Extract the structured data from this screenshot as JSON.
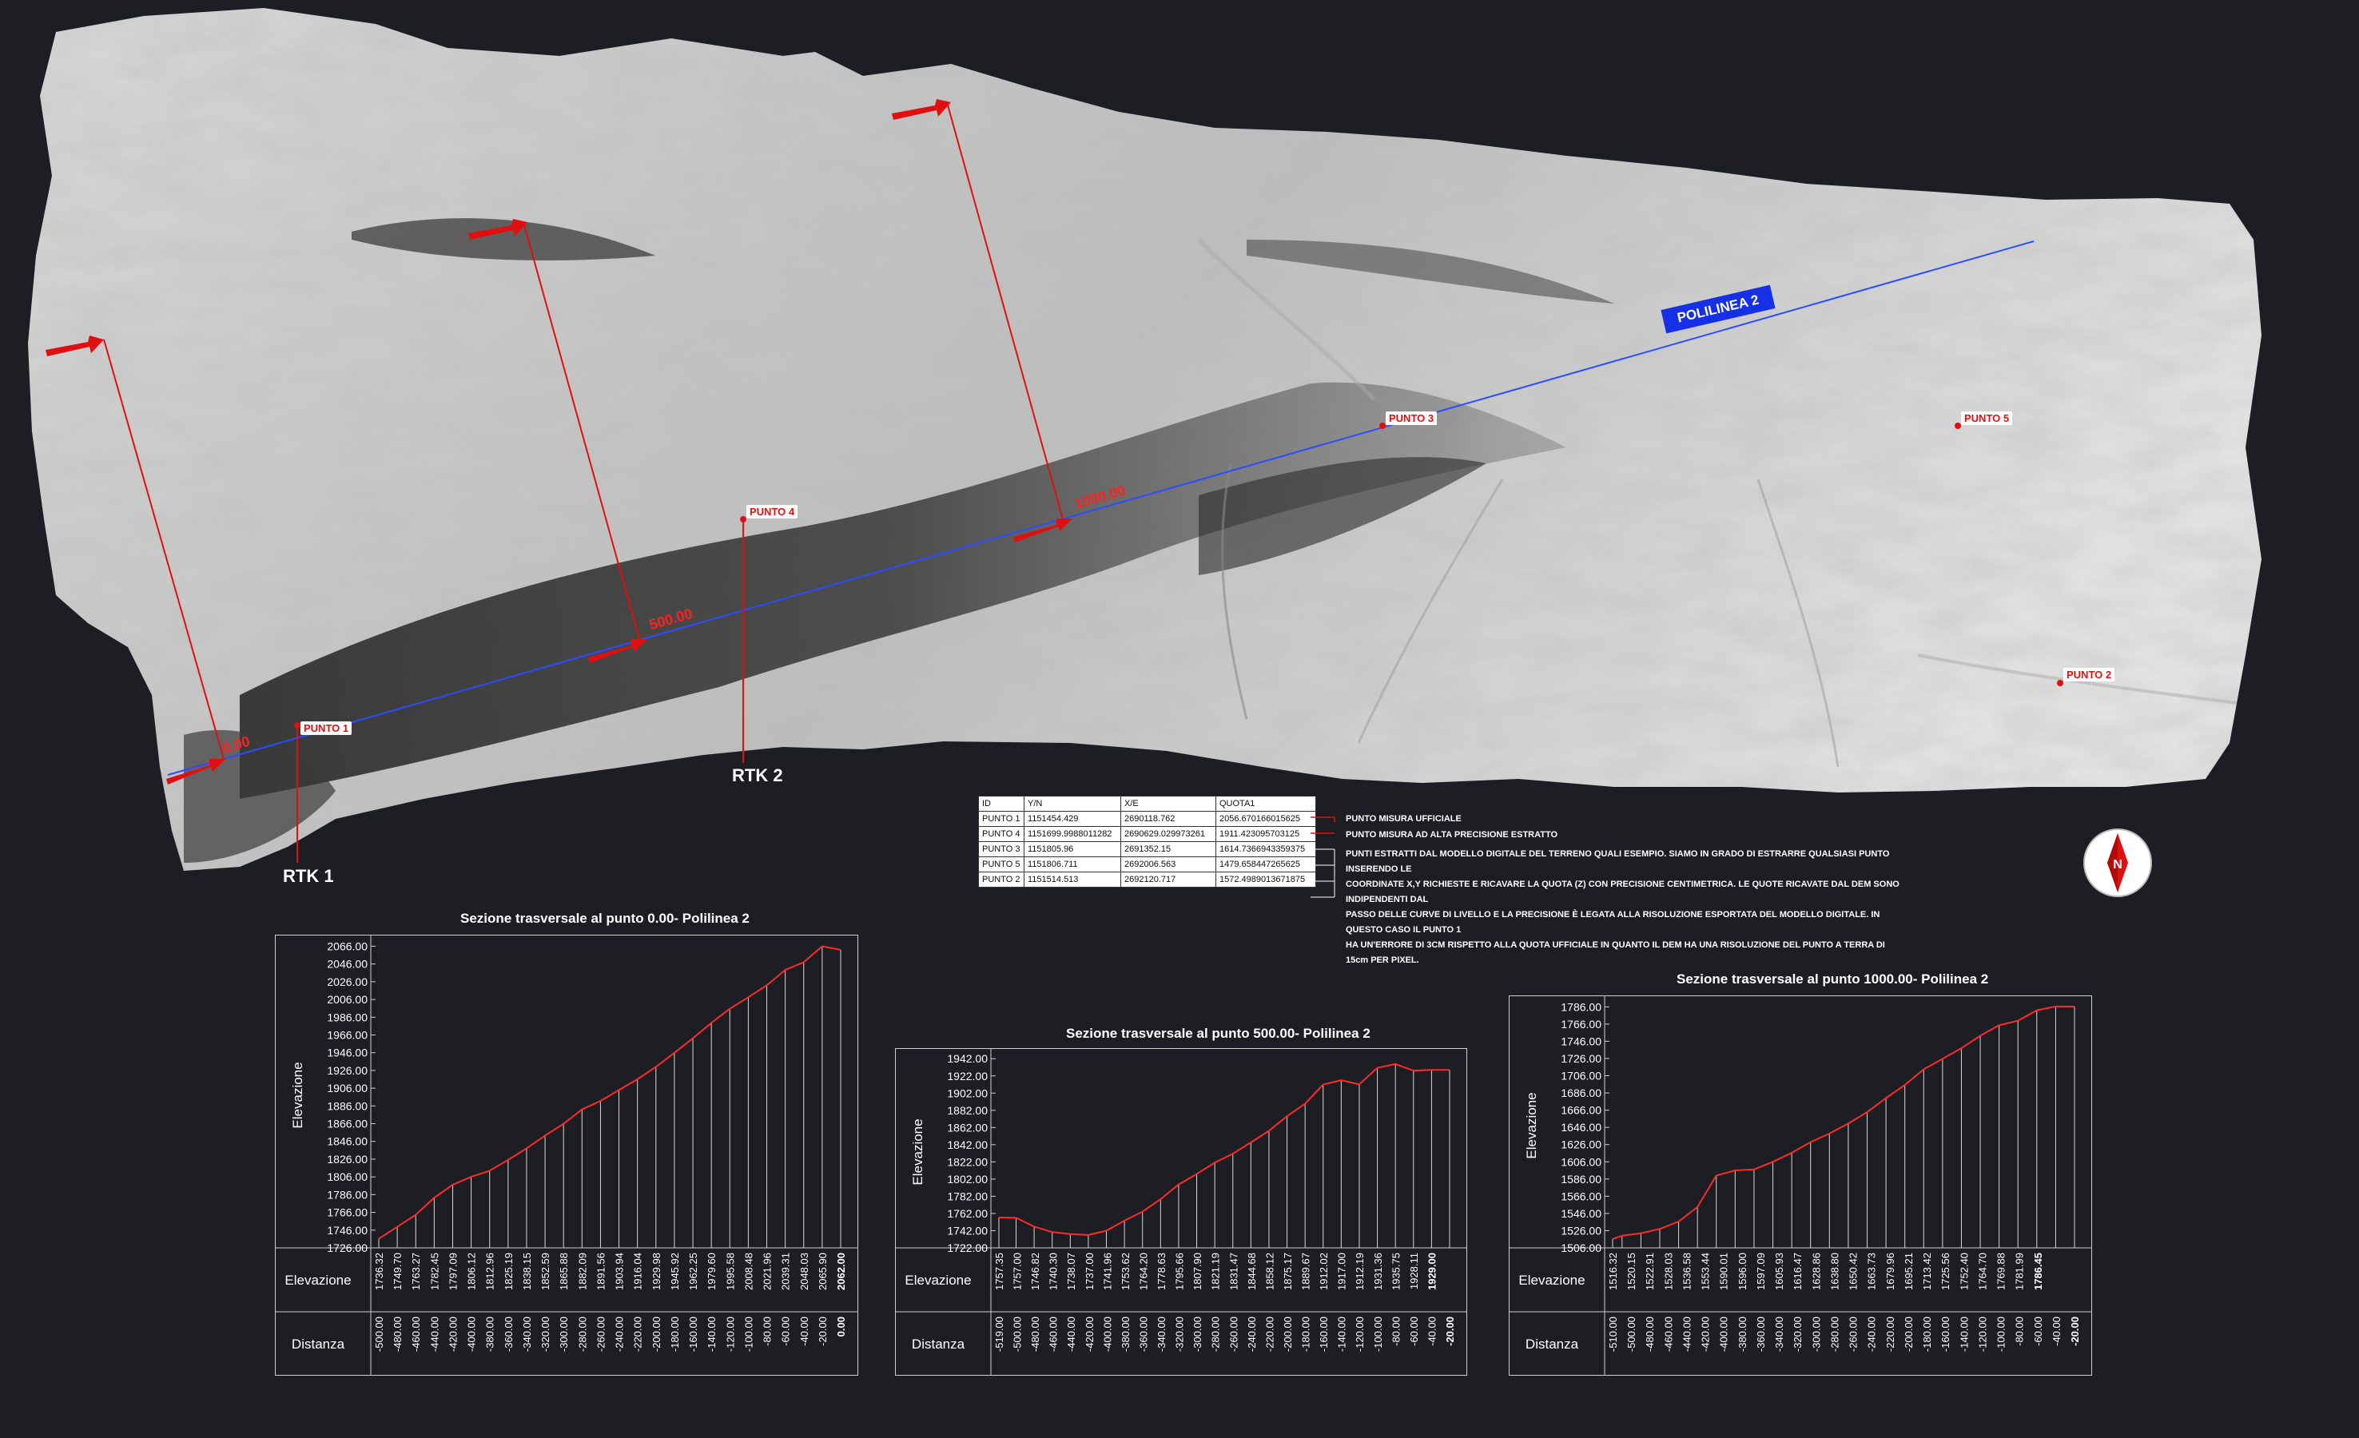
{
  "map": {
    "polyline_label": "POLILINEA 2",
    "distance_markers": [
      "0.00",
      "500.00",
      "1000.00"
    ],
    "points": [
      {
        "label": "PUNTO 1"
      },
      {
        "label": "PUNTO 4"
      },
      {
        "label": "PUNTO 3"
      },
      {
        "label": "PUNTO 5"
      },
      {
        "label": "PUNTO 2"
      }
    ],
    "rtk": [
      "RTK 1",
      "RTK 2"
    ],
    "compass_letter": "N",
    "colors": {
      "background": "#1d1e24",
      "polyline": "#2a4dff",
      "marker": "#e01010",
      "badge": "#1530e6"
    }
  },
  "table": {
    "headers": [
      "ID",
      "Y/N",
      "X/E",
      "QUOTA1"
    ],
    "rows": [
      [
        "PUNTO 1",
        "1151454.429",
        "2690118.762",
        "2056.670166015625"
      ],
      [
        "PUNTO 4",
        "1151699.9988011282",
        "2690629.029973261",
        "1911.423095703125"
      ],
      [
        "PUNTO 3",
        "1151805.96",
        "2691352.15",
        "1614.7366943359375"
      ],
      [
        "PUNTO 5",
        "1151806.711",
        "2692006.563",
        "1479.658447265625"
      ],
      [
        "PUNTO 2",
        "1151514.513",
        "2692120.717",
        "1572.4989013671875"
      ]
    ]
  },
  "legend": {
    "official": "PUNTO MISURA UFFICIALE",
    "high_precision": "PUNTO MISURA AD ALTA PRECISIONE ESTRATTO",
    "note_lines": [
      "PUNTI ESTRATTI DAL MODELLO DIGITALE DEL TERRENO QUALI ESEMPIO. SIAMO IN GRADO DI ESTRARRE QUALSIASI PUNTO INSERENDO LE",
      "COORDINATE X,Y RICHIESTE E RICAVARE LA QUOTA (Z) CON PRECISIONE CENTIMETRICA. LE QUOTE RICAVATE DAL DEM SONO INDIPENDENTI DAL",
      "PASSO DELLE CURVE DI LIVELLO E LA PRECISIONE È LEGATA ALLA RISOLUZIONE ESPORTATA DEL MODELLO DIGITALE. IN QUESTO CASO IL PUNTO 1",
      "HA UN'ERRORE DI 3CM RISPETTO ALLA QUOTA UFFICIALE IN QUANTO IL DEM HA UNA RISOLUZIONE DEL PUNTO A TERRA DI 15cm PER PIXEL."
    ]
  },
  "chart_data": [
    {
      "type": "area",
      "title": "Sezione trasversale al punto 0.00- Polilinea 2",
      "ylabel": "Elevazione",
      "row_labels": [
        "Elevazione",
        "Distanza"
      ],
      "yticks": [
        "1726.00",
        "1746.00",
        "1766.00",
        "1786.00",
        "1806.00",
        "1826.00",
        "1846.00",
        "1866.00",
        "1886.00",
        "1906.00",
        "1926.00",
        "1946.00",
        "1966.00",
        "1986.00",
        "2006.00",
        "2026.00",
        "2046.00",
        "2066.00"
      ],
      "ylim": [
        1726,
        2070
      ],
      "elev_labels": [
        "1736.32",
        "1749.70",
        "1763.27",
        "1782.45",
        "1797.09",
        "1806.12",
        "1812.96",
        "1825.19",
        "1838.15",
        "1852.59",
        "1865.88",
        "1882.09",
        "1891.56",
        "1903.94",
        "1916.04",
        "1929.98",
        "1945.92",
        "1962.25",
        "1979.60",
        "1995.58",
        "2008.48",
        "2021.96",
        "2039.31",
        "2048.03",
        "2065.90",
        "2062.00"
      ],
      "dist_labels": [
        "-500.00",
        "-480.00",
        "-460.00",
        "-440.00",
        "-420.00",
        "-400.00",
        "-380.00",
        "-360.00",
        "-340.00",
        "-320.00",
        "-300.00",
        "-280.00",
        "-260.00",
        "-240.00",
        "-220.00",
        "-200.00",
        "-180.00",
        "-160.00",
        "-140.00",
        "-120.00",
        "-100.00",
        "-80.00",
        "-60.00",
        "-40.00",
        "-20.00",
        "0.00"
      ],
      "x": [
        -500,
        -480,
        -460,
        -440,
        -420,
        -400,
        -380,
        -360,
        -340,
        -320,
        -300,
        -280,
        -260,
        -240,
        -220,
        -200,
        -180,
        -160,
        -140,
        -120,
        -100,
        -80,
        -60,
        -40,
        -20,
        0
      ],
      "values": [
        1736.32,
        1749.7,
        1763.27,
        1782.45,
        1797.09,
        1806.12,
        1812.96,
        1825.19,
        1838.15,
        1852.59,
        1865.88,
        1882.09,
        1891.56,
        1903.94,
        1916.04,
        1929.98,
        1945.92,
        1962.25,
        1979.6,
        1995.58,
        2008.48,
        2021.96,
        2039.31,
        2048.03,
        2065.9,
        2062.0
      ]
    },
    {
      "type": "area",
      "title": "Sezione trasversale al punto 500.00- Polilinea 2",
      "ylabel": "Elevazione",
      "row_labels": [
        "Elevazione",
        "Distanza"
      ],
      "yticks": [
        "1722.00",
        "1742.00",
        "1762.00",
        "1782.00",
        "1802.00",
        "1822.00",
        "1842.00",
        "1862.00",
        "1882.00",
        "1902.00",
        "1922.00",
        "1942.00"
      ],
      "ylim": [
        1722,
        1945
      ],
      "elev_labels": [
        "1757.35",
        "1757.00",
        "1746.82",
        "1740.30",
        "1738.07",
        "1737.00",
        "1741.96",
        "1753.62",
        "1764.20",
        "1778.63",
        "1795.66",
        "1807.90",
        "1821.19",
        "1831.47",
        "1844.68",
        "1858.12",
        "1875.17",
        "1889.67",
        "1912.02",
        "1917.00",
        "1912.19",
        "1931.36",
        "1935.75",
        "1928.11",
        "1929.00"
      ],
      "dist_labels": [
        "-519.00",
        "-500.00",
        "-480.00",
        "-460.00",
        "-440.00",
        "-420.00",
        "-400.00",
        "-380.00",
        "-360.00",
        "-340.00",
        "-320.00",
        "-300.00",
        "-280.00",
        "-260.00",
        "-240.00",
        "-220.00",
        "-200.00",
        "-180.00",
        "-160.00",
        "-140.00",
        "-120.00",
        "-100.00",
        "-80.00",
        "-60.00",
        "-40.00",
        "-20.00"
      ],
      "x": [
        -519,
        -500,
        -480,
        -460,
        -440,
        -420,
        -400,
        -380,
        -360,
        -340,
        -320,
        -300,
        -280,
        -260,
        -240,
        -220,
        -200,
        -180,
        -160,
        -140,
        -120,
        -100,
        -80,
        -60,
        -40,
        -20
      ],
      "values": [
        1757.35,
        1757.0,
        1746.82,
        1740.3,
        1738.07,
        1737.0,
        1741.96,
        1753.62,
        1764.2,
        1778.63,
        1795.66,
        1807.9,
        1821.19,
        1831.47,
        1844.68,
        1858.12,
        1875.17,
        1889.67,
        1912.02,
        1917.0,
        1912.19,
        1931.36,
        1935.75,
        1928.11,
        1929.0,
        1929.0
      ]
    },
    {
      "type": "area",
      "title": "Sezione trasversale al punto 1000.00- Polilinea 2",
      "ylabel": "Elevazione",
      "row_labels": [
        "Elevazione",
        "Distanza"
      ],
      "yticks": [
        "1506.00",
        "1526.00",
        "1546.00",
        "1566.00",
        "1586.00",
        "1606.00",
        "1626.00",
        "1646.00",
        "1666.00",
        "1686.00",
        "1706.00",
        "1726.00",
        "1746.00",
        "1766.00",
        "1786.00"
      ],
      "ylim": [
        1506,
        1790
      ],
      "elev_labels": [
        "1516.32",
        "1520.15",
        "1522.91",
        "1528.03",
        "1536.58",
        "1553.44",
        "1590.01",
        "1596.00",
        "1597.09",
        "1605.93",
        "1616.47",
        "1628.86",
        "1638.80",
        "1650.42",
        "1663.73",
        "1679.96",
        "1695.21",
        "1713.42",
        "1725.56",
        "1752.40",
        "1764.70",
        "1769.88",
        "1781.99",
        "1786.45"
      ],
      "dist_labels": [
        "-510.00",
        "-500.00",
        "-480.00",
        "-460.00",
        "-440.00",
        "-420.00",
        "-400.00",
        "-380.00",
        "-360.00",
        "-340.00",
        "-320.00",
        "-300.00",
        "-280.00",
        "-260.00",
        "-240.00",
        "-220.00",
        "-200.00",
        "-180.00",
        "-160.00",
        "-140.00",
        "-120.00",
        "-100.00",
        "-80.00",
        "-60.00",
        "-40.00",
        "-20.00"
      ],
      "x": [
        -510,
        -500,
        -480,
        -460,
        -440,
        -420,
        -400,
        -380,
        -360,
        -340,
        -320,
        -300,
        -280,
        -260,
        -240,
        -220,
        -200,
        -180,
        -160,
        -140,
        -120,
        -100,
        -80,
        -60,
        -40,
        -20
      ],
      "values": [
        1516.32,
        1520.15,
        1522.91,
        1528.03,
        1536.58,
        1553.44,
        1590.01,
        1596.0,
        1597.09,
        1605.93,
        1616.47,
        1628.86,
        1638.8,
        1650.42,
        1663.73,
        1679.96,
        1695.21,
        1713.42,
        1725.56,
        1738.0,
        1752.4,
        1764.7,
        1769.88,
        1781.99,
        1786.45,
        1786.45
      ]
    }
  ]
}
